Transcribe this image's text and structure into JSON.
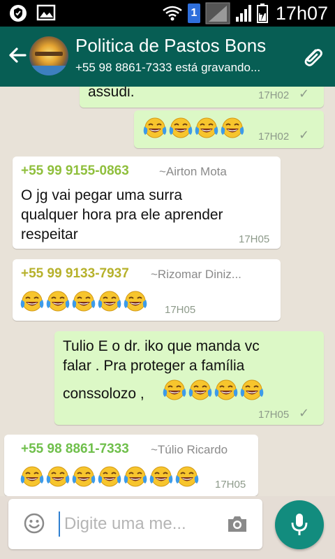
{
  "status_bar": {
    "sim_badge": "1",
    "time": "17h07"
  },
  "header": {
    "title": "Politica de Pastos Bons",
    "subtitle": "+55 98 8861-7333 está gravando..."
  },
  "messages": [
    {
      "type": "out",
      "text": "assudi.",
      "time": "17H02",
      "status": "sent-tick"
    },
    {
      "type": "out",
      "emoji_count": 4,
      "time": "17H02",
      "status": "sent-tick"
    },
    {
      "type": "in",
      "sender": "+55 99 9155-0863",
      "alias": "~Airton Mota",
      "lines": [
        "O jg vai pegar uma  surra",
        "qualquer hora pra ele aprender",
        "respeitar"
      ],
      "time": "17H05"
    },
    {
      "type": "in",
      "sender": "+55 99 9133-7937",
      "alias": "~Rizomar Diniz...",
      "emoji_count": 5,
      "time": "17H05"
    },
    {
      "type": "out",
      "lines": [
        "Tulio  E o dr. iko que manda vc",
        "falar . Pra proteger a família"
      ],
      "last_line": "conssolozo ,",
      "emoji_count": 4,
      "time": "17H05",
      "status": "sent-tick"
    },
    {
      "type": "in",
      "sender": "+55 98 8861-7333",
      "alias": "~Túlio Ricardo",
      "emoji_count": 7,
      "time": "17H05"
    }
  ],
  "input": {
    "placeholder": "Digite uma me..."
  },
  "colors": {
    "header": "#075e54",
    "outgoing": "#dcf8c6",
    "incoming": "#ffffff",
    "fab": "#128c7e"
  }
}
